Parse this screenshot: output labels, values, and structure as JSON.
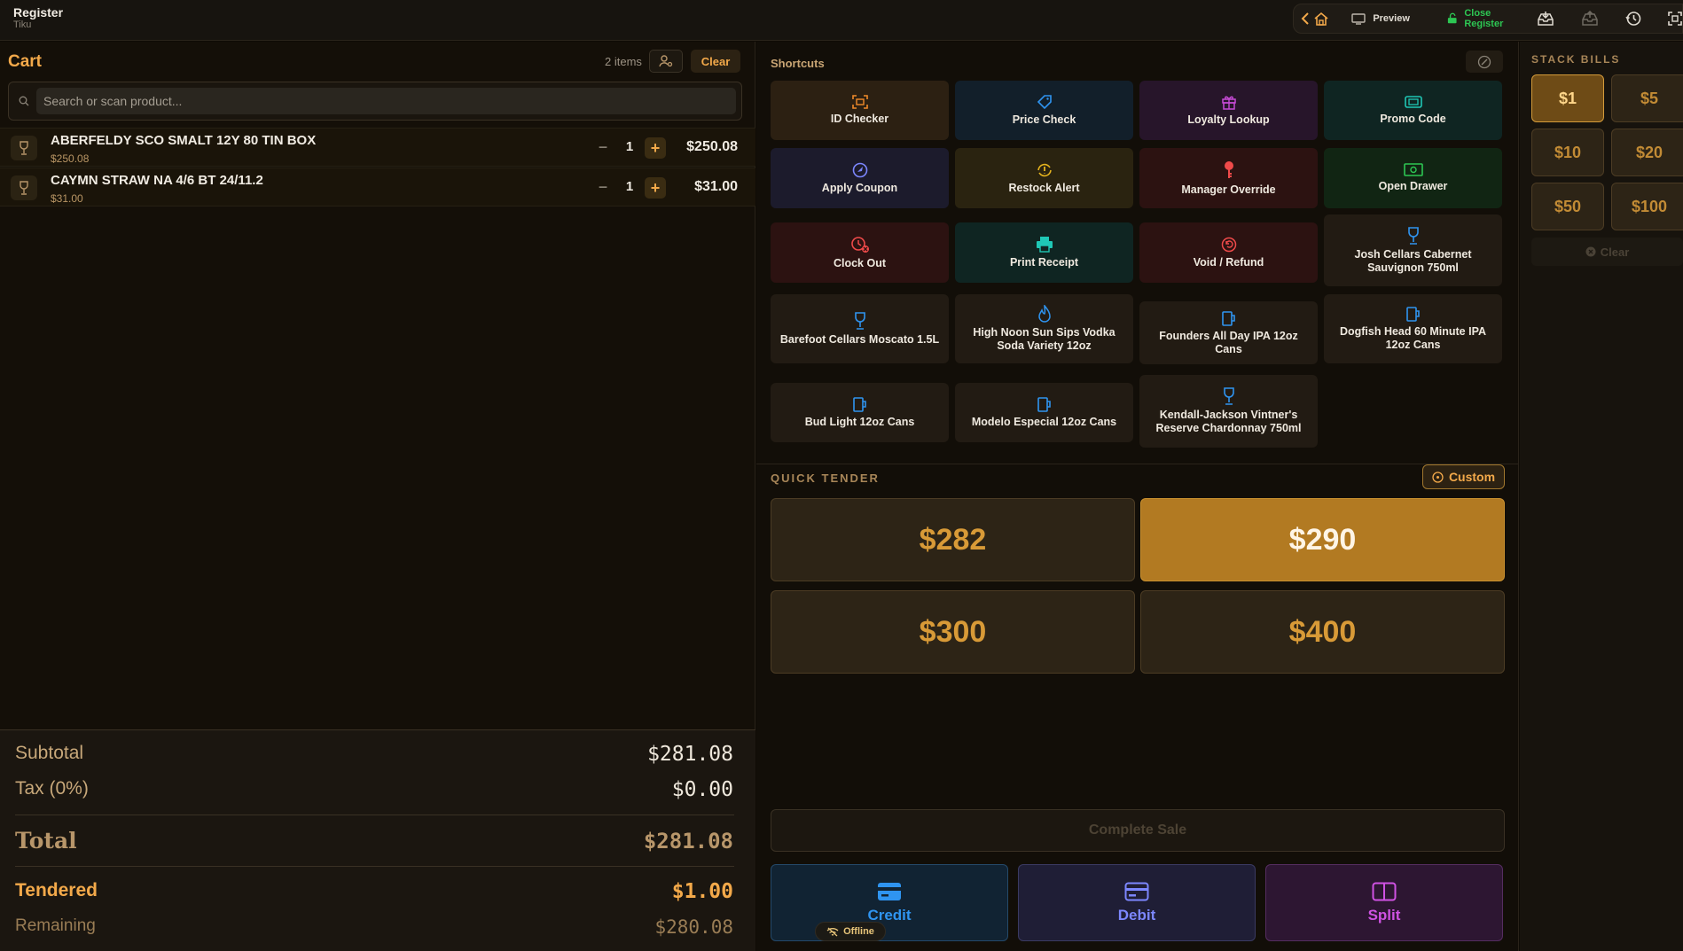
{
  "app": {
    "title": "Register",
    "subtitle": "Tiku"
  },
  "topbar": {
    "preview_label": "Preview",
    "close_register_label": "Close Register"
  },
  "cart": {
    "title": "Cart",
    "item_count": "2 items",
    "clear_label": "Clear",
    "search_placeholder": "Search or scan product...",
    "items": [
      {
        "name": "ABERFELDY SCO SMALT 12Y 80 TIN BOX",
        "unit_price": "$250.08",
        "qty": "1",
        "total": "$250.08"
      },
      {
        "name": "CAYMN STRAW NA 4/6 BT 24/11.2",
        "unit_price": "$31.00",
        "qty": "1",
        "total": "$31.00"
      }
    ],
    "qty_minus": "−",
    "qty_plus": "+"
  },
  "totals": {
    "subtotal_label": "Subtotal",
    "subtotal": "$281.08",
    "tax_label": "Tax (0%)",
    "tax": "$0.00",
    "total_label": "Total",
    "total": "$281.08",
    "tendered_label": "Tendered",
    "tendered": "$1.00",
    "remaining_label": "Remaining",
    "remaining": "$280.08"
  },
  "shortcuts": {
    "title": "Shortcuts",
    "tiles": [
      {
        "label": "ID Checker",
        "icon": "id-scan-icon",
        "color": "#f08a2a"
      },
      {
        "label": "Price Check",
        "icon": "tag-icon",
        "color": "#2f94f0"
      },
      {
        "label": "Loyalty Lookup",
        "icon": "gift-icon",
        "color": "#c74bd6"
      },
      {
        "label": "Promo Code",
        "icon": "ticket-icon",
        "color": "#1fc7b5"
      },
      {
        "label": "Apply Coupon",
        "icon": "coupon-icon",
        "color": "#7c87ff"
      },
      {
        "label": "Restock Alert",
        "icon": "restock-icon",
        "color": "#e6b41e"
      },
      {
        "label": "Manager Override",
        "icon": "key-icon",
        "color": "#ef4a4a"
      },
      {
        "label": "Open Drawer",
        "icon": "cash-icon",
        "color": "#2dc653"
      },
      {
        "label": "Clock Out",
        "icon": "clock-out-icon",
        "color": "#ef4a4a"
      },
      {
        "label": "Print Receipt",
        "icon": "printer-icon",
        "color": "#1fc7b5"
      },
      {
        "label": "Void / Refund",
        "icon": "refund-icon",
        "color": "#ef4a4a"
      },
      {
        "label": "Josh Cellars Cabernet Sauvignon 750ml",
        "icon": "wine-glass-icon",
        "color": "#2f94f0"
      },
      {
        "label": "Barefoot Cellars Moscato 1.5L",
        "icon": "wine-glass-icon",
        "color": "#2f94f0"
      },
      {
        "label": "High Noon Sun Sips Vodka Soda Variety 12oz",
        "icon": "flame-icon",
        "color": "#2f94f0"
      },
      {
        "label": "Founders All Day IPA 12oz Cans",
        "icon": "beer-mug-icon",
        "color": "#2f94f0"
      },
      {
        "label": "Dogfish Head 60 Minute IPA 12oz Cans",
        "icon": "beer-mug-icon",
        "color": "#2f94f0"
      },
      {
        "label": "Bud Light 12oz Cans",
        "icon": "beer-mug-icon",
        "color": "#2f94f0"
      },
      {
        "label": "Modelo Especial 12oz Cans",
        "icon": "beer-mug-icon",
        "color": "#2f94f0"
      },
      {
        "label": "Kendall-Jackson Vintner's Reserve Chardonnay 750ml",
        "icon": "wine-glass-icon",
        "color": "#2f94f0"
      }
    ]
  },
  "quick_tender": {
    "title": "QUICK TENDER",
    "custom_label": "Custom",
    "amounts": [
      "$282",
      "$290",
      "$300",
      "$400"
    ]
  },
  "actions": {
    "complete_label": "Complete Sale",
    "credit_label": "Credit",
    "debit_label": "Debit",
    "split_label": "Split",
    "offline_label": "Offline"
  },
  "stack_bills": {
    "title": "STACK BILLS",
    "bills": [
      "$1",
      "$5",
      "$10",
      "$20",
      "$50",
      "$100"
    ],
    "clear_label": "Clear"
  }
}
